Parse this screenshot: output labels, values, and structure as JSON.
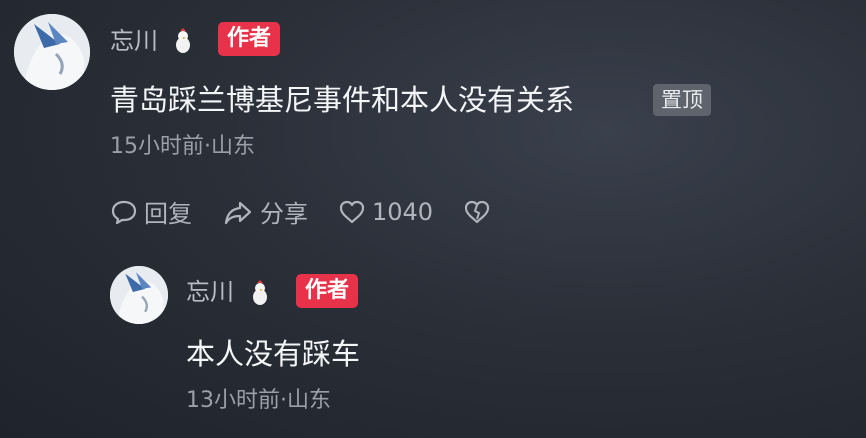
{
  "comment": {
    "author": "忘川",
    "author_badge": "作者",
    "text": "青岛踩兰博基尼事件和本人没有关系",
    "pinned_label": "置顶",
    "meta": "15小时前·山东",
    "actions": {
      "reply_label": "回复",
      "share_label": "分享",
      "like_count": "1040"
    }
  },
  "reply": {
    "author": "忘川",
    "author_badge": "作者",
    "text": "本人没有踩车",
    "meta": "13小时前·山东"
  },
  "colors": {
    "badge": "#e8324a",
    "pin": "#5e636c"
  },
  "icons": [
    "avatar",
    "chick-icon",
    "comment-icon",
    "share-icon",
    "heart-icon",
    "broken-heart-icon"
  ]
}
